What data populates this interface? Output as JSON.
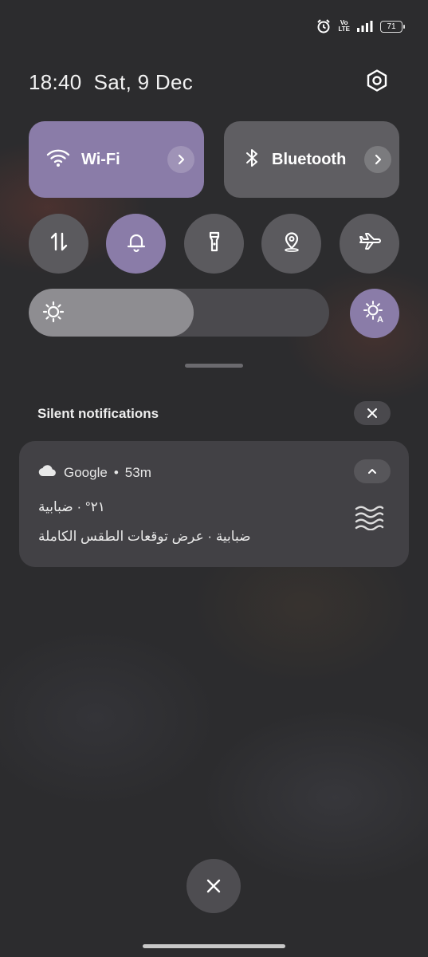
{
  "status_bar": {
    "alarm_icon": "alarm-clock-icon",
    "volte_top": "Vo",
    "volte_bottom": "LTE",
    "signal_icon": "signal-bars-icon",
    "battery_level": "71"
  },
  "header": {
    "time": "18:40",
    "date": "Sat, 9 Dec",
    "settings_icon": "gear-icon"
  },
  "tiles": {
    "wifi": {
      "label": "Wi-Fi",
      "state": "on",
      "icon": "wifi-icon"
    },
    "bluetooth": {
      "label": "Bluetooth",
      "state": "off",
      "icon": "bluetooth-icon"
    }
  },
  "toggles": [
    {
      "name": "mobile-data",
      "icon": "data-arrows-icon",
      "state": "off"
    },
    {
      "name": "sound",
      "icon": "bell-icon",
      "state": "on"
    },
    {
      "name": "flashlight",
      "icon": "flashlight-icon",
      "state": "off"
    },
    {
      "name": "location",
      "icon": "location-pin-icon",
      "state": "off"
    },
    {
      "name": "airplane-mode",
      "icon": "airplane-icon",
      "state": "off"
    }
  ],
  "brightness": {
    "level": 0.55,
    "auto_icon": "auto-brightness-icon"
  },
  "notifications": {
    "section_label": "Silent notifications",
    "items": [
      {
        "app": "Google",
        "time": "53m",
        "title": "٢١° · ضبابية",
        "body": "ضبابية · عرض توقعات الطقس الكاملة",
        "icon": "fog-icon"
      }
    ]
  },
  "colors": {
    "accent": "#8a7ca8",
    "tile_off": "#5f5e62",
    "card_bg": "#424145",
    "background": "#2c2c2e"
  }
}
